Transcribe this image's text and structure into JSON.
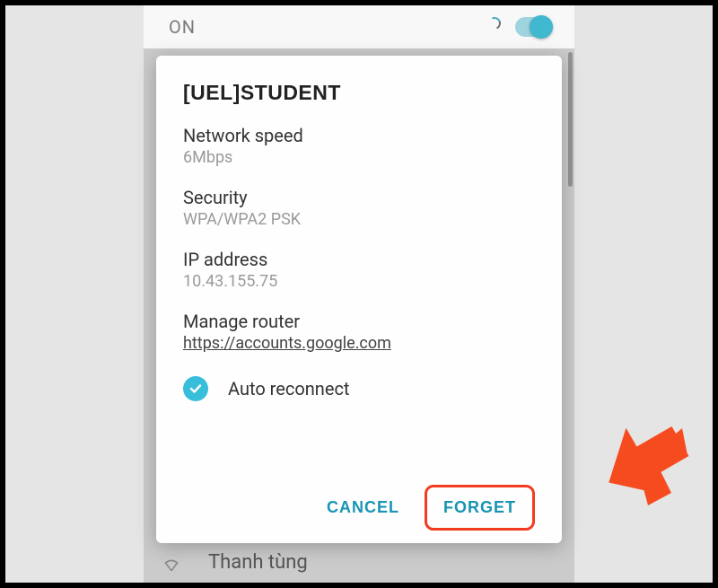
{
  "topbar": {
    "wifi_state": "ON"
  },
  "background": {
    "partial_top_letter": "",
    "partial_mid_letter": "",
    "bottom_network": "Thanh tùng"
  },
  "dialog": {
    "title": "[UEL]STUDENT",
    "fields": {
      "speed_label": "Network speed",
      "speed_value": "6Mbps",
      "security_label": "Security",
      "security_value": "WPA/WPA2 PSK",
      "ip_label": "IP address",
      "ip_value": "10.43.155.75",
      "router_label": "Manage router",
      "router_value": "https://accounts.google.com"
    },
    "auto_reconnect_label": "Auto reconnect",
    "auto_reconnect_checked": true,
    "actions": {
      "cancel": "CANCEL",
      "forget": "FORGET"
    }
  },
  "colors": {
    "accent": "#36bedb",
    "highlight": "#f43b1f"
  }
}
